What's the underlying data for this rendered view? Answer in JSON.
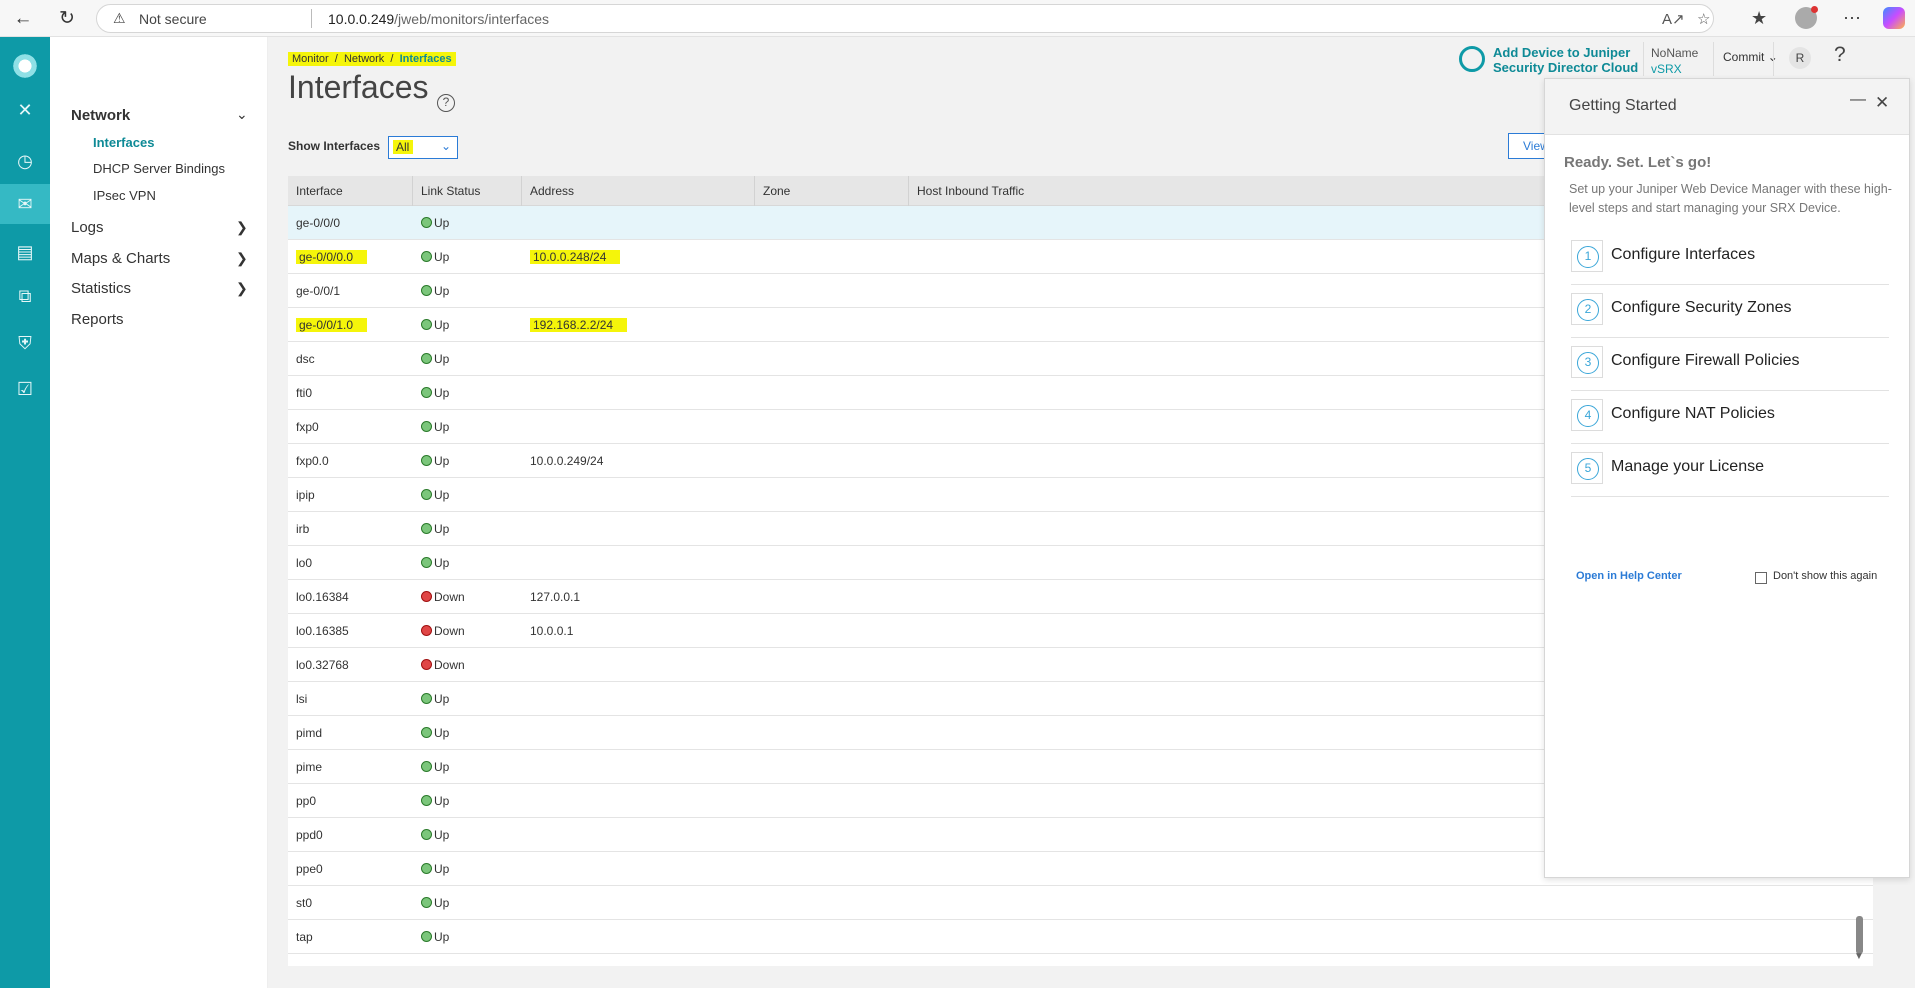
{
  "browser": {
    "warning": "Not secure",
    "url_host": "10.0.0.249",
    "url_path": "/jweb/monitors/interfaces"
  },
  "rail": {
    "items": [
      "logo-icon",
      "close-icon",
      "dashboard-icon",
      "monitor-icon",
      "device-icon",
      "network-icon",
      "security-icon",
      "lock-icon"
    ]
  },
  "sidemenu": {
    "network_label": "Network",
    "network_items": [
      "Interfaces",
      "DHCP Server Bindings",
      "IPsec VPN"
    ],
    "logs_label": "Logs",
    "maps_label": "Maps & Charts",
    "statistics_label": "Statistics",
    "reports_label": "Reports"
  },
  "header": {
    "cloud_line1": "Add Device to Juniper",
    "cloud_line2": "Security Director Cloud",
    "device_name": "NoName",
    "device_model": "vSRX",
    "commit_label": "Commit",
    "avatar_letter": "R",
    "help_label": "?"
  },
  "breadcrumb": {
    "items": [
      "Monitor",
      "Network",
      "Interfaces"
    ]
  },
  "page": {
    "title": "Interfaces",
    "show_label": "Show Interfaces",
    "show_value": "All",
    "view_label": "View"
  },
  "table": {
    "columns": [
      "Interface",
      "Link Status",
      "Address",
      "Zone",
      "Host Inbound Traffic"
    ],
    "rows": [
      {
        "interface": "ge-0/0/0",
        "status": "Up",
        "address": ""
      },
      {
        "interface": "ge-0/0/0.0",
        "status": "Up",
        "address": "10.0.0.248/24"
      },
      {
        "interface": "ge-0/0/1",
        "status": "Up",
        "address": ""
      },
      {
        "interface": "ge-0/0/1.0",
        "status": "Up",
        "address": "192.168.2.2/24"
      },
      {
        "interface": "dsc",
        "status": "Up",
        "address": ""
      },
      {
        "interface": "fti0",
        "status": "Up",
        "address": ""
      },
      {
        "interface": "fxp0",
        "status": "Up",
        "address": ""
      },
      {
        "interface": "fxp0.0",
        "status": "Up",
        "address": "10.0.0.249/24"
      },
      {
        "interface": "ipip",
        "status": "Up",
        "address": ""
      },
      {
        "interface": "irb",
        "status": "Up",
        "address": ""
      },
      {
        "interface": "lo0",
        "status": "Up",
        "address": ""
      },
      {
        "interface": "lo0.16384",
        "status": "Down",
        "address": "127.0.0.1"
      },
      {
        "interface": "lo0.16385",
        "status": "Down",
        "address": "10.0.0.1"
      },
      {
        "interface": "lo0.32768",
        "status": "Down",
        "address": ""
      },
      {
        "interface": "lsi",
        "status": "Up",
        "address": ""
      },
      {
        "interface": "pimd",
        "status": "Up",
        "address": ""
      },
      {
        "interface": "pime",
        "status": "Up",
        "address": ""
      },
      {
        "interface": "pp0",
        "status": "Up",
        "address": ""
      },
      {
        "interface": "ppd0",
        "status": "Up",
        "address": ""
      },
      {
        "interface": "ppe0",
        "status": "Up",
        "address": ""
      },
      {
        "interface": "st0",
        "status": "Up",
        "address": ""
      },
      {
        "interface": "tap",
        "status": "Up",
        "address": ""
      }
    ]
  },
  "getting_started": {
    "title": "Getting Started",
    "ready": "Ready. Set. Let`s go!",
    "description": "Set up your Juniper Web Device Manager with these high-level steps and start managing your SRX Device.",
    "steps": [
      {
        "num": "1",
        "label": "Configure Interfaces"
      },
      {
        "num": "2",
        "label": "Configure Security Zones"
      },
      {
        "num": "3",
        "label": "Configure Firewall Policies"
      },
      {
        "num": "4",
        "label": "Configure NAT Policies"
      },
      {
        "num": "5",
        "label": "Manage your License"
      }
    ],
    "help_link": "Open in Help Center",
    "dont_show": "Don't show this again"
  },
  "colors": {
    "accent": "#0e9aa7",
    "highlight": "#f5f50a",
    "up": "#7bc67b",
    "down": "#e04646"
  }
}
